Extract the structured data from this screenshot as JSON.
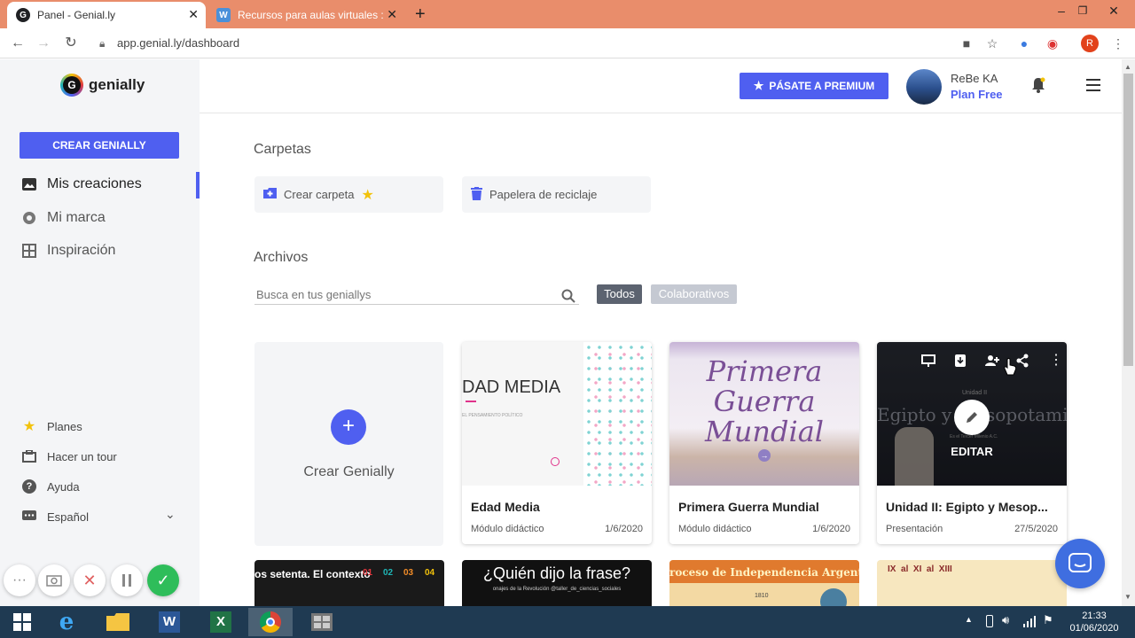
{
  "browser": {
    "tabs": [
      {
        "title": "Panel - Genial.ly",
        "favicon": "G",
        "favicon_color": "#202124"
      },
      {
        "title": "Recursos para aulas virtuales :: Ta",
        "favicon": "W",
        "favicon_color": "#4a90d9"
      }
    ],
    "url": "app.genial.ly/dashboard",
    "profile_initial": "R"
  },
  "sidebar": {
    "logo_text": "genially",
    "create_button": "CREAR GENIALLY",
    "nav": [
      {
        "label": "Mis creaciones",
        "icon": "image-icon"
      },
      {
        "label": "Mi marca",
        "icon": "brand-icon"
      },
      {
        "label": "Inspiración",
        "icon": "grid-icon"
      }
    ],
    "bottom": [
      {
        "label": "Planes",
        "icon": "star-icon"
      },
      {
        "label": "Hacer un tour",
        "icon": "briefcase-icon"
      },
      {
        "label": "Ayuda",
        "icon": "help-icon"
      },
      {
        "label": "Español",
        "icon": "chat-icon"
      }
    ]
  },
  "header": {
    "premium_button": "PÁSATE A PREMIUM",
    "user_name": "ReBe KA",
    "user_plan": "Plan Free"
  },
  "folders": {
    "heading": "Carpetas",
    "create_folder": "Crear carpeta",
    "trash": "Papelera de reciclaje"
  },
  "files": {
    "heading": "Archivos",
    "search_placeholder": "Busca en tus geniallys",
    "filter_all": "Todos",
    "filter_collab": "Colaborativos",
    "create_card_label": "Crear Genially",
    "cards": [
      {
        "title": "Edad Media",
        "type": "Módulo didáctico",
        "date": "1/6/2020",
        "thumb_text": "DAD MEDIA",
        "thumb_subtext": "EL PENSAMIENTO POLÍTICO"
      },
      {
        "title": "Primera Guerra Mundial",
        "type": "Módulo didáctico",
        "date": "1/6/2020",
        "thumb_text_1": "Primera",
        "thumb_text_2": "Guerra",
        "thumb_text_3": "Mundial"
      },
      {
        "title": "Unidad II: Egipto y Mesop...",
        "type": "Presentación",
        "date": "27/5/2020",
        "thumb_text": "Egipto y Mesopotamia",
        "thumb_small": "Unidad II",
        "thumb_sub": "Es el Tercer Milenio A.C.",
        "edit_label": "EDITAR"
      }
    ],
    "row2": [
      {
        "text": "os setenta. El contexto",
        "nums": [
          "01",
          "02",
          "03",
          "04"
        ]
      },
      {
        "text": "¿Quién dijo la frase?",
        "sub": "onajes de la Revolución @taller_de_ciencias_sociales"
      },
      {
        "text": "roceso de Independencia Argentin",
        "year": "1810"
      },
      {
        "text": "IX  al  XI  al  XIII"
      }
    ]
  },
  "taskbar": {
    "time": "21:33",
    "date": "01/06/2020"
  },
  "colors": {
    "accent": "#4f5ff0",
    "tabstrip": "#e98d6b",
    "sidebar_bg": "#f4f5f7",
    "taskbar": "#1f3a52",
    "record_green": "#2ebd5a"
  }
}
